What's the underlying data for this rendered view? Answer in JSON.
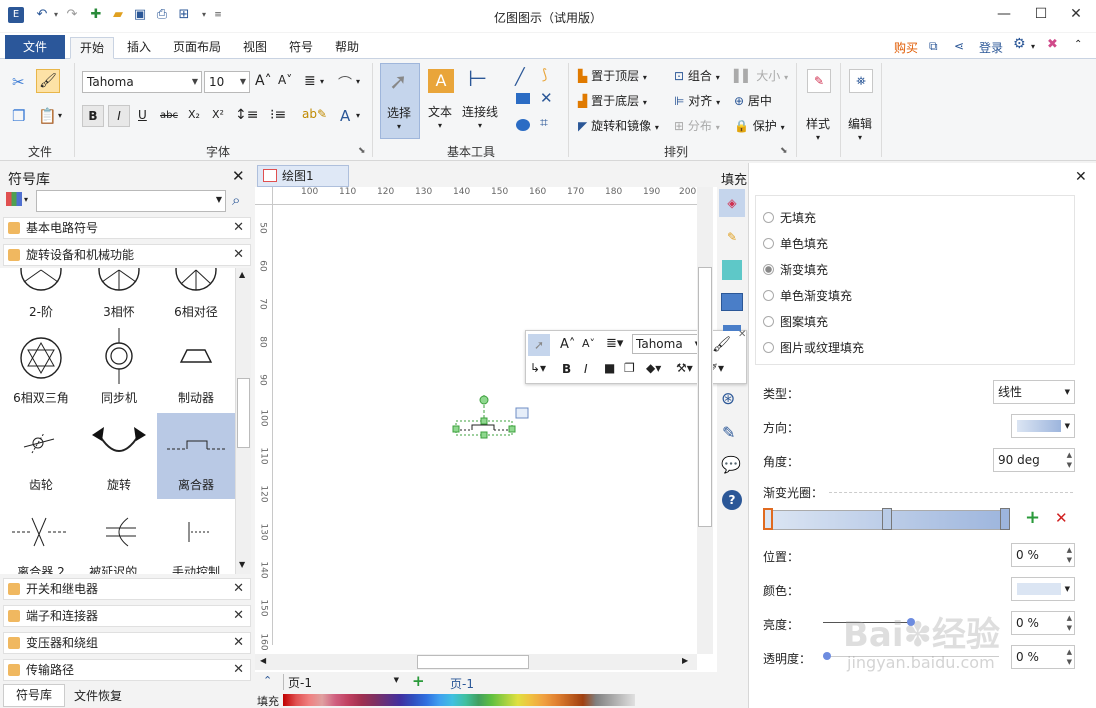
{
  "window": {
    "title": "亿图图示（试用版）",
    "minimize": "—",
    "maximize": "☐",
    "close": "✕"
  },
  "menu": {
    "tabs": [
      "文件",
      "开始",
      "插入",
      "页面布局",
      "视图",
      "符号",
      "帮助"
    ],
    "active_tab": "开始",
    "buy": "购买",
    "login": "登录"
  },
  "ribbon": {
    "groups": {
      "file": "文件",
      "font": "字体",
      "basic_tools": "基本工具",
      "arrange": "排列"
    },
    "font_name": "Tahoma",
    "font_size": "10",
    "tools": {
      "select": "选择",
      "text": "文本",
      "connector": "连接线"
    },
    "arrange": {
      "bring_front": "置于顶层",
      "send_back": "置于底层",
      "rotate_mirror": "旋转和镜像",
      "group": "组合",
      "align": "对齐",
      "distribute": "分布",
      "size": "大小",
      "center": "居中",
      "protect": "保护"
    },
    "style": "样式",
    "edit": "编辑"
  },
  "library": {
    "title": "符号库",
    "search_placeholder": "",
    "sections_top": [
      "基本电路符号",
      "旋转设备和机械功能"
    ],
    "shapes": [
      {
        "label": "2-阶"
      },
      {
        "label": "3相怀"
      },
      {
        "label": "6相对径"
      },
      {
        "label": "6相双三角"
      },
      {
        "label": "同步机"
      },
      {
        "label": "制动器"
      },
      {
        "label": "齿轮"
      },
      {
        "label": "旋转"
      },
      {
        "label": "离合器"
      },
      {
        "label": "离合器 2"
      },
      {
        "label": "被延迟的..."
      },
      {
        "label": "手动控制"
      }
    ],
    "sections_bottom": [
      "开关和继电器",
      "端子和连接器",
      "变压器和绕组",
      "传输路径"
    ],
    "bottom_tabs": [
      "符号库",
      "文件恢复"
    ]
  },
  "canvas": {
    "doc_tab": "绘图1",
    "ruler_h": [
      "100",
      "110",
      "120",
      "130",
      "140",
      "150",
      "160",
      "170",
      "180",
      "190",
      "200"
    ],
    "ruler_v": [
      "50",
      "60",
      "70",
      "80",
      "90",
      "100",
      "110",
      "120",
      "130",
      "140",
      "150",
      "160"
    ],
    "mini_font": "Tahoma"
  },
  "pages": {
    "current": "页-1",
    "tab": "页-1",
    "fill_label": "填充"
  },
  "fill_panel": {
    "title": "填充",
    "options": [
      "无填充",
      "单色填充",
      "渐变填充",
      "单色渐变填充",
      "图案填充",
      "图片或纹理填充"
    ],
    "selected_option": "渐变填充",
    "type_label": "类型：",
    "type_value": "线性",
    "direction_label": "方向：",
    "angle_label": "角度：",
    "angle_value": "90 deg",
    "gradient_label": "渐变光圈：",
    "position_label": "位置：",
    "position_value": "0 %",
    "color_label": "颜色：",
    "brightness_label": "亮度：",
    "brightness_value": "0 %",
    "transparency_label": "透明度：",
    "transparency_value": "0 %"
  },
  "watermark": {
    "text1": "Bai",
    "text2": "经验",
    "url": "jingyan.baidu.com"
  }
}
